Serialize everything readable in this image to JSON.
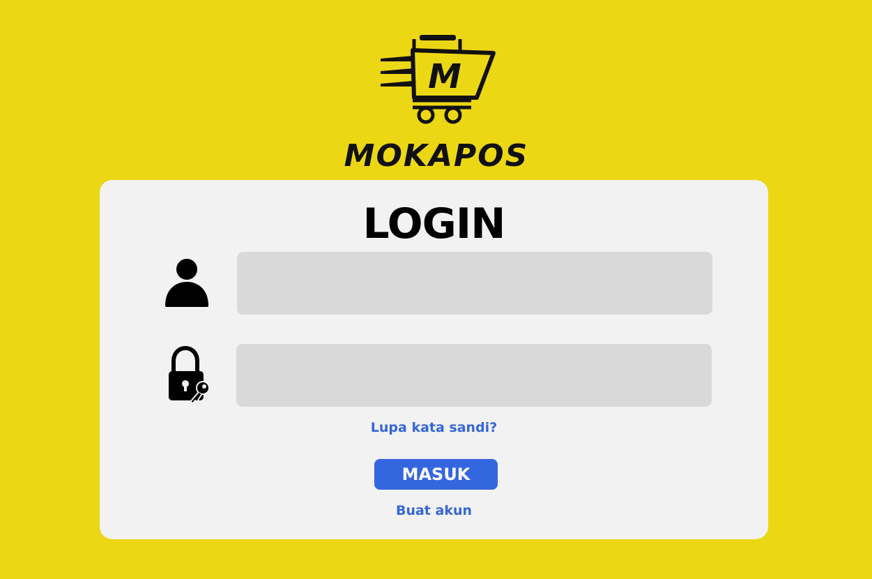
{
  "brand": {
    "logo_letter": "M",
    "name": "MOKAPOS",
    "logo_icon": "shopping-cart-icon"
  },
  "login": {
    "title": "LOGIN",
    "username": {
      "icon": "user-icon",
      "value": "",
      "placeholder": ""
    },
    "password": {
      "icon": "lock-key-icon",
      "value": "",
      "placeholder": ""
    },
    "forgot_link": "Lupa kata sandi?",
    "submit_label": "MASUK",
    "register_link": "Buat akun"
  },
  "colors": {
    "background": "#ECD714",
    "card": "#F3F2F3",
    "input": "#D9D9D9",
    "accent": "#3466E0",
    "link": "#3466D6"
  }
}
